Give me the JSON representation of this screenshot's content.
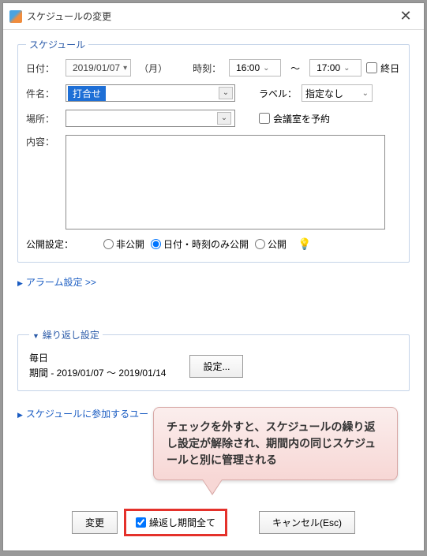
{
  "titlebar": {
    "title": "スケジュールの変更"
  },
  "schedule": {
    "legend": "スケジュール",
    "date_label": "日付：",
    "date_value": "2019/01/07",
    "day_of_week": "（月）",
    "time_label": "時刻：",
    "time_start": "16:00",
    "time_sep": "～",
    "time_end": "17:00",
    "allday_label": "終日",
    "subject_label": "件名：",
    "subject_value": "打合せ",
    "label_label": "ラベル：",
    "label_value": "指定なし",
    "place_label": "場所：",
    "place_value": "",
    "reserve_room": "会議室を予約",
    "content_label": "内容：",
    "privacy_label": "公開設定：",
    "privacy_private": "非公開",
    "privacy_datetime": "日付・時刻のみ公開",
    "privacy_public": "公開"
  },
  "alarm_link": "アラーム設定 >>",
  "recurrence": {
    "legend": "繰り返し設定",
    "freq": "毎日",
    "period": "期間 - 2019/01/07 ～ 2019/01/14",
    "settings_btn": "設定..."
  },
  "participants_link": "スケジュールに参加するユー",
  "balloon_text": "チェックを外すと、スケジュールの繰り返し設定が解除され、期間内の同じスケジュールと別に管理される",
  "buttons": {
    "change": "変更",
    "repeat_all": "繰返し期間全て",
    "cancel": "キャンセル(Esc)"
  }
}
